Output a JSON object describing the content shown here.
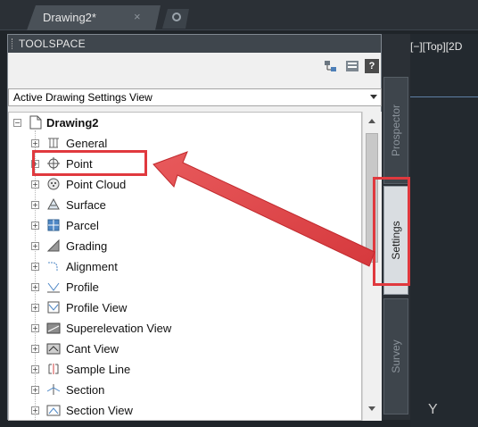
{
  "tabstrip": {
    "document_tab_label": "Drawing2*",
    "close_glyph": "×"
  },
  "toolspace": {
    "title": "TOOLSPACE",
    "toolbar": {
      "help_label": "?"
    },
    "view_selector": "Active Drawing Settings View"
  },
  "tree": {
    "root_label": "Drawing2",
    "items": [
      {
        "label": "General",
        "icon": "general-icon"
      },
      {
        "label": "Point",
        "icon": "point-icon"
      },
      {
        "label": "Point Cloud",
        "icon": "point-cloud-icon"
      },
      {
        "label": "Surface",
        "icon": "surface-icon"
      },
      {
        "label": "Parcel",
        "icon": "parcel-icon"
      },
      {
        "label": "Grading",
        "icon": "grading-icon"
      },
      {
        "label": "Alignment",
        "icon": "alignment-icon"
      },
      {
        "label": "Profile",
        "icon": "profile-icon"
      },
      {
        "label": "Profile View",
        "icon": "profile-view-icon"
      },
      {
        "label": "Superelevation View",
        "icon": "superelevation-view-icon"
      },
      {
        "label": "Cant View",
        "icon": "cant-view-icon"
      },
      {
        "label": "Sample Line",
        "icon": "sample-line-icon"
      },
      {
        "label": "Section",
        "icon": "section-icon"
      },
      {
        "label": "Section View",
        "icon": "section-view-icon"
      }
    ]
  },
  "side_tabs": {
    "prospector": "Prospector",
    "settings": "Settings",
    "survey": "Survey"
  },
  "viewport": {
    "label": "[−][Top][2D",
    "axis_label": "Y"
  },
  "colors": {
    "highlight": "#e0393e",
    "panel_bg": "#f0f0f0",
    "dark_bg": "#23292f"
  }
}
